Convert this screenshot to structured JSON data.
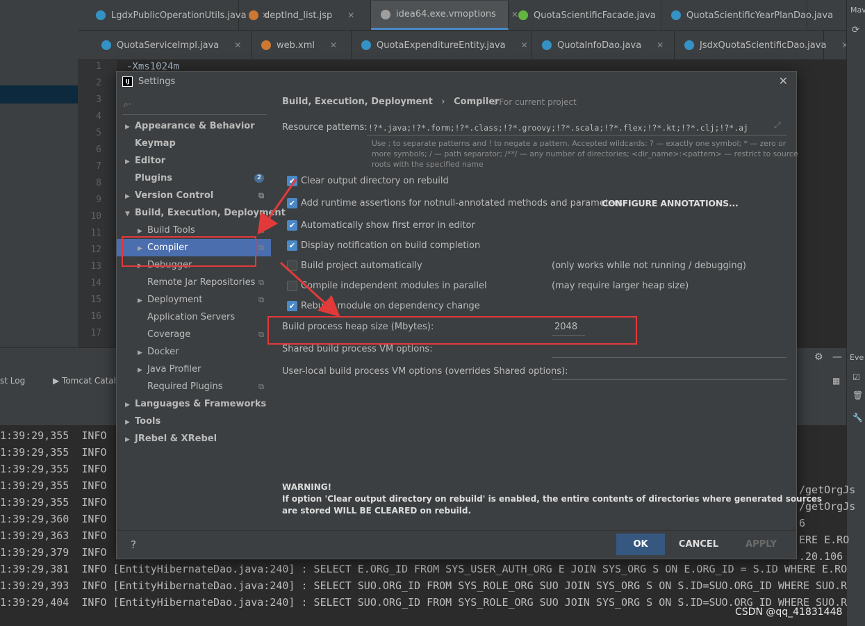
{
  "editor_tabs_row1": [
    {
      "label": "LgdxPublicOperationUtils.java",
      "icon_color": "#3592c4"
    },
    {
      "label": "deptInd_list.jsp",
      "icon_color": "#cc7832"
    },
    {
      "label": "idea64.exe.vmoptions",
      "icon_color": "#9e9e9e"
    },
    {
      "label": "QuotaScientificFacade.java",
      "icon_color": "#62b543"
    },
    {
      "label": "QuotaScientificYearPlanDao.java",
      "icon_color": "#3592c4"
    }
  ],
  "editor_tabs_row2": [
    {
      "label": "QuotaServiceImpl.java",
      "icon_color": "#3592c4"
    },
    {
      "label": "web.xml",
      "icon_color": "#cc7832"
    },
    {
      "label": "QuotaExpenditureEntity.java",
      "icon_color": "#3592c4"
    },
    {
      "label": "QuotaInfoDao.java",
      "icon_color": "#3592c4"
    },
    {
      "label": "JsdxQuotaScientificDao.java",
      "icon_color": "#3592c4"
    }
  ],
  "editor": {
    "first_line": "-Xms1024m",
    "line_numbers": [
      "1",
      "2",
      "3",
      "4",
      "5",
      "6",
      "7",
      "8",
      "9",
      "10",
      "11",
      "12",
      "13",
      "14",
      "15",
      "16",
      "17"
    ]
  },
  "right_toolbar": {
    "title": "Mav"
  },
  "events_label": "Eve",
  "bottom_tabs": {
    "log": "st Log",
    "tomcat": "Tomcat Catalin"
  },
  "console_lines": [
    "1:39:29,355  INFO",
    "1:39:29,355  INFO",
    "1:39:29,355  INFO",
    "1:39:29,355  INFO",
    "1:39:29,355  INFO",
    "1:39:29,360  INFO",
    "1:39:29,363  INFO",
    "1:39:29,379  INFO",
    "1:39:29,381  INFO [EntityHibernateDao.java:240] : SELECT E.ORG_ID FROM SYS_USER_AUTH_ORG E JOIN SYS_ORG S ON E.ORG_ID = S.ID WHERE E.RO",
    "1:39:29,393  INFO [EntityHibernateDao.java:240] : SELECT SUO.ORG_ID FROM SYS_ROLE_ORG SUO JOIN SYS_ORG S ON S.ID=SUO.ORG_ID WHERE SUO.R",
    "1:39:29,404  INFO [EntityHibernateDao.java:240] : SELECT SUO.ORG_ID FROM SYS_ROLE_ORG SUO JOIN SYS_ORG S ON S.ID=SUO.ORG_ID WHERE SUO.R"
  ],
  "console_right_fragments": [
    "/getOrgJs",
    "/getOrgJs",
    "6",
    "ERE E.RO",
    ".20.106"
  ],
  "watermark": "CSDN @qq_41831448",
  "dialog": {
    "title": "Settings",
    "tree": [
      {
        "label": "Appearance & Behavior",
        "bold": true,
        "arrow": "▶",
        "indent": 0
      },
      {
        "label": "Keymap",
        "bold": true,
        "arrow": "",
        "indent": 0
      },
      {
        "label": "Editor",
        "bold": true,
        "arrow": "▶",
        "indent": 0
      },
      {
        "label": "Plugins",
        "bold": true,
        "arrow": "",
        "indent": 0,
        "badge": "2"
      },
      {
        "label": "Version Control",
        "bold": true,
        "arrow": "▶",
        "indent": 0,
        "proj": true
      },
      {
        "label": "Build, Execution, Deployment",
        "bold": true,
        "arrow": "▼",
        "indent": 0
      },
      {
        "label": "Build Tools",
        "bold": false,
        "arrow": "▶",
        "indent": 1,
        "proj": true
      },
      {
        "label": "Compiler",
        "bold": false,
        "arrow": "▶",
        "indent": 1,
        "proj": true,
        "selected": true
      },
      {
        "label": "Debugger",
        "bold": false,
        "arrow": "▶",
        "indent": 1
      },
      {
        "label": "Remote Jar Repositories",
        "bold": false,
        "arrow": "",
        "indent": 1,
        "proj": true
      },
      {
        "label": "Deployment",
        "bold": false,
        "arrow": "▶",
        "indent": 1,
        "proj": true
      },
      {
        "label": "Application Servers",
        "bold": false,
        "arrow": "",
        "indent": 1
      },
      {
        "label": "Coverage",
        "bold": false,
        "arrow": "",
        "indent": 1,
        "proj": true
      },
      {
        "label": "Docker",
        "bold": false,
        "arrow": "▶",
        "indent": 1
      },
      {
        "label": "Java Profiler",
        "bold": false,
        "arrow": "▶",
        "indent": 1
      },
      {
        "label": "Required Plugins",
        "bold": false,
        "arrow": "",
        "indent": 1,
        "proj": true
      },
      {
        "label": "Languages & Frameworks",
        "bold": true,
        "arrow": "▶",
        "indent": 0
      },
      {
        "label": "Tools",
        "bold": true,
        "arrow": "▶",
        "indent": 0
      },
      {
        "label": "JRebel & XRebel",
        "bold": true,
        "arrow": "▶",
        "indent": 0
      }
    ],
    "breadcrumb": {
      "parent": "Build, Execution, Deployment",
      "sep": "›",
      "current": "Compiler",
      "scope": "For current project"
    },
    "resource_patterns": {
      "label": "Resource patterns:",
      "value": "!?*.java;!?*.form;!?*.class;!?*.groovy;!?*.scala;!?*.flex;!?*.kt;!?*.clj;!?*.aj",
      "hint_line1": "Use ; to separate patterns and ! to negate a pattern. Accepted wildcards: ? — exactly one symbol; * — zero or",
      "hint_line2": "more symbols; / — path separator; /**/ — any number of directories; <dir_name>:<pattern> — restrict to source",
      "hint_line3": "roots with the specified name"
    },
    "options": [
      {
        "label": "Clear output directory on rebuild",
        "checked": true,
        "note": ""
      },
      {
        "label": "Add runtime assertions for notnull-annotated methods and parameters",
        "checked": true,
        "note": ""
      },
      {
        "label": "Automatically show first error in editor",
        "checked": true,
        "note": ""
      },
      {
        "label": "Display notification on build completion",
        "checked": true,
        "note": ""
      },
      {
        "label": "Build project automatically",
        "checked": false,
        "note": "(only works while not running / debugging)"
      },
      {
        "label": "Compile independent modules in parallel",
        "checked": false,
        "note": "(may require larger heap size)"
      },
      {
        "label": "Rebuild module on dependency change",
        "checked": true,
        "note": ""
      }
    ],
    "configure_annotations": "CONFIGURE ANNOTATIONS...",
    "heap": {
      "label": "Build process heap size (Mbytes):",
      "value": "2048"
    },
    "shared_vm": {
      "label": "Shared build process VM options:",
      "value": ""
    },
    "user_vm": {
      "label": "User-local build process VM options (overrides Shared options):",
      "value": ""
    },
    "warning": {
      "title": "WARNING!",
      "line1": "If option 'Clear output directory on rebuild' is enabled, the entire contents of directories where generated sources",
      "line2": "are stored WILL BE CLEARED on rebuild."
    },
    "buttons": {
      "help": "?",
      "ok": "OK",
      "cancel": "CANCEL",
      "apply": "APPLY"
    },
    "colors": {
      "accent": "#4b6eaf",
      "ok_button": "#365880",
      "annotation_red": "#e23a3a"
    }
  }
}
